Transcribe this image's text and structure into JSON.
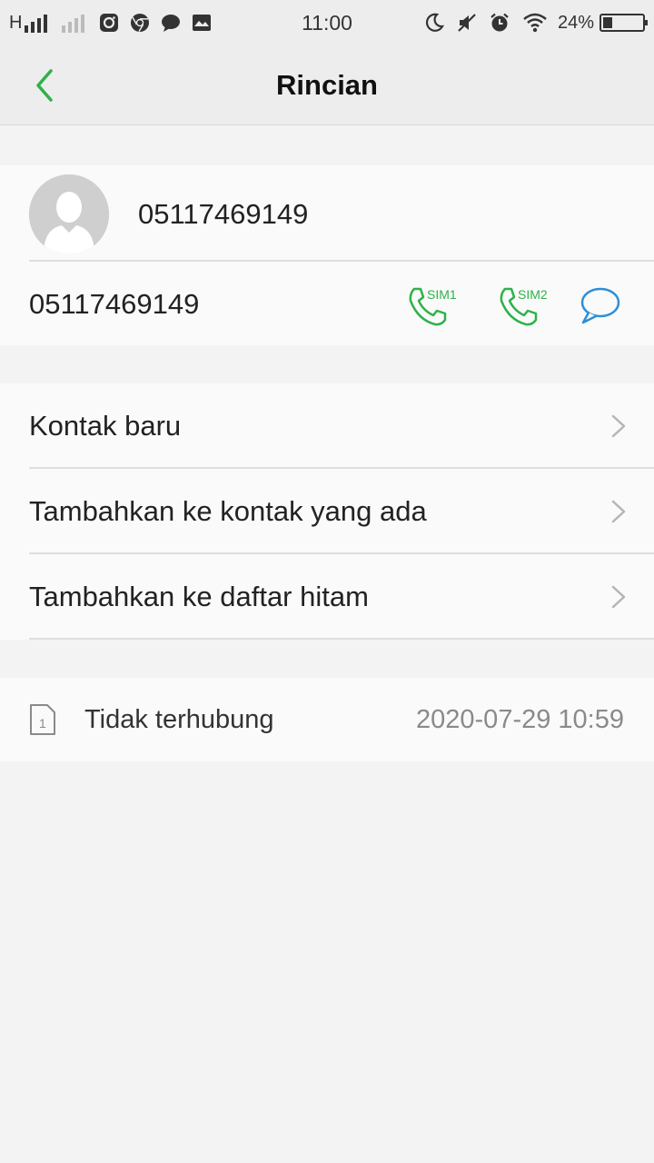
{
  "status_bar": {
    "network_type": "H",
    "time": "11:00",
    "battery_percent": "24%",
    "battery_level": 0.24
  },
  "header": {
    "title": "Rincian"
  },
  "contact": {
    "name": "05117469149",
    "number": "05117469149",
    "sim1_label": "SIM1",
    "sim2_label": "SIM2"
  },
  "actions": [
    {
      "label": "Kontak baru"
    },
    {
      "label": "Tambahkan ke kontak yang ada"
    },
    {
      "label": "Tambahkan ke daftar hitam"
    }
  ],
  "call_log": {
    "sim_number": "1",
    "status": "Tidak terhubung",
    "datetime": "2020-07-29 10:59"
  },
  "colors": {
    "accent_green": "#2db24a",
    "message_blue": "#2d8fd8"
  }
}
